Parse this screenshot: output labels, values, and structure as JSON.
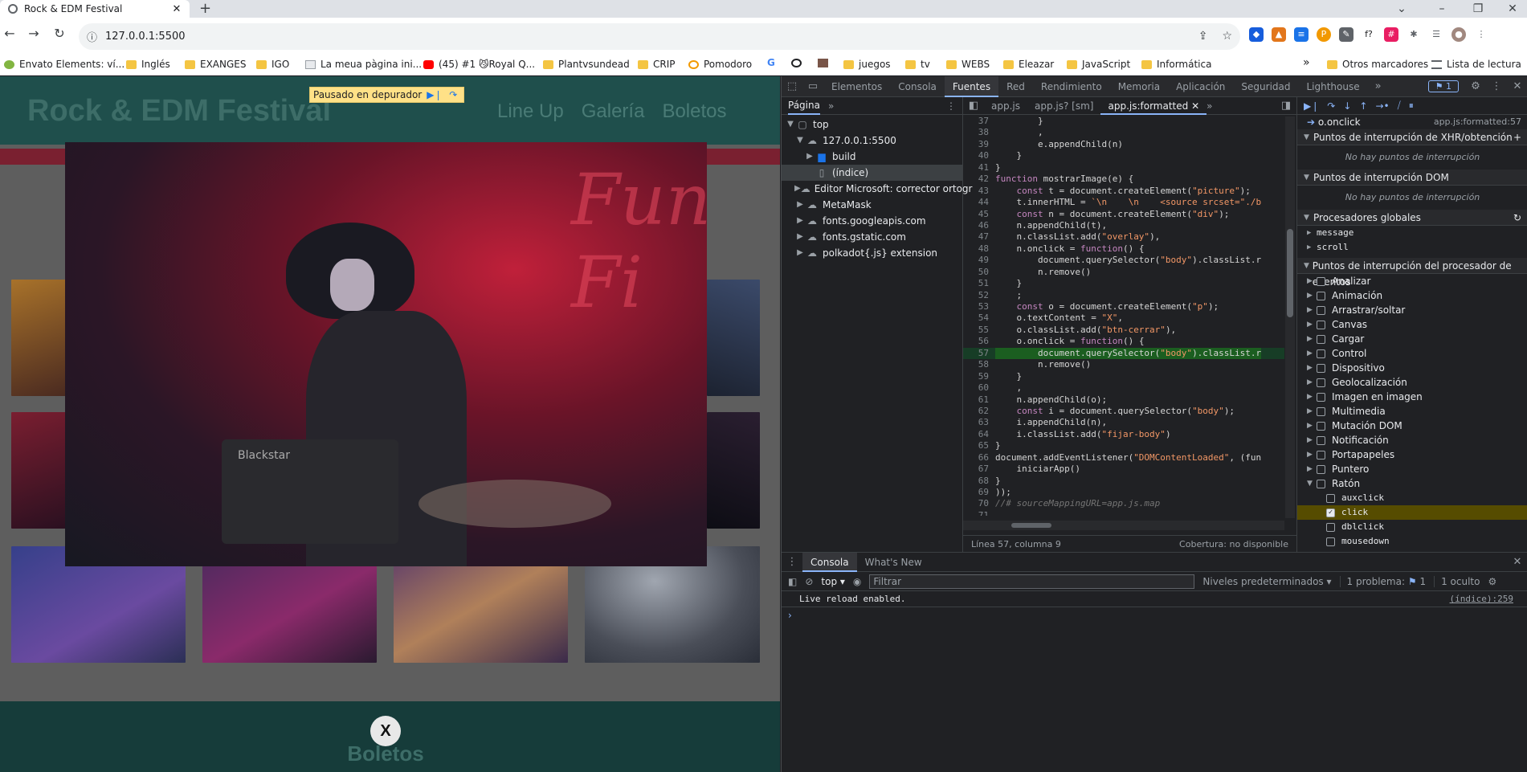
{
  "browser": {
    "tab_title": "Rock & EDM Festival",
    "url": "127.0.0.1:5500",
    "bookmarks": [
      "Envato Elements: ví...",
      "Inglés",
      "EXANGES",
      "IGO",
      "La meua pàgina ini...",
      "(45) #1 😼Royal Q...",
      "Plantvsundead",
      "CRIP",
      "Pomodoro",
      "",
      "",
      "",
      "juegos",
      "tv",
      "WEBS",
      "Eleazar",
      "JavaScript",
      "Informática"
    ],
    "other_bookmarks": "Otros marcadores",
    "reading_list": "Lista de lectura",
    "overflow": "»"
  },
  "site": {
    "title": "Rock & EDM Festival",
    "nav": [
      "Line Up",
      "Galería",
      "Boletos"
    ],
    "paused_text": "Pausado en depurador",
    "photo_sign": "Fun Fi",
    "amp_label": "Blackstar",
    "close_label": "X",
    "footer_title": "Boletos"
  },
  "devtools": {
    "tabs": [
      "Elementos",
      "Consola",
      "Fuentes",
      "Red",
      "Rendimiento",
      "Memoria",
      "Aplicación",
      "Seguridad",
      "Lighthouse"
    ],
    "active_tab": "Fuentes",
    "issue_count": "1",
    "navigator_tab": "Página",
    "tree": [
      {
        "label": "top",
        "level": 0,
        "icon": "frame",
        "open": true
      },
      {
        "label": "127.0.0.1:5500",
        "level": 1,
        "icon": "cloud",
        "open": true
      },
      {
        "label": "build",
        "level": 2,
        "icon": "folder",
        "open": false
      },
      {
        "label": "(índice)",
        "level": 2,
        "icon": "file",
        "selected": true
      },
      {
        "label": "Editor Microsoft: corrector ortogr",
        "level": 1,
        "icon": "cloud",
        "open": false
      },
      {
        "label": "MetaMask",
        "level": 1,
        "icon": "cloud",
        "open": false
      },
      {
        "label": "fonts.googleapis.com",
        "level": 1,
        "icon": "cloud",
        "open": false
      },
      {
        "label": "fonts.gstatic.com",
        "level": 1,
        "icon": "cloud",
        "open": false
      },
      {
        "label": "polkadot{.js} extension",
        "level": 1,
        "icon": "cloud",
        "open": false
      }
    ],
    "editor_tabs": [
      "app.js",
      "app.js? [sm]",
      "app.js:formatted"
    ],
    "code": [
      {
        "n": "37",
        "t": "        }"
      },
      {
        "n": "38",
        "t": "        ,"
      },
      {
        "n": "39",
        "t": "        e.appendChild(n)"
      },
      {
        "n": "40",
        "t": "    }"
      },
      {
        "n": "41",
        "t": "}"
      },
      {
        "n": "42",
        "t": "function mostrarImage(e) {"
      },
      {
        "n": "43",
        "t": "    const t = document.createElement(\"picture\");"
      },
      {
        "n": "44",
        "t": "    t.innerHTML = `\\n    \\n    <source srcset=\"./b"
      },
      {
        "n": "45",
        "t": "    const n = document.createElement(\"div\");"
      },
      {
        "n": "46",
        "t": "    n.appendChild(t),"
      },
      {
        "n": "47",
        "t": "    n.classList.add(\"overlay\"),"
      },
      {
        "n": "48",
        "t": "    n.onclick = function() {"
      },
      {
        "n": "49",
        "t": "        document.querySelector(\"body\").classList.r"
      },
      {
        "n": "50",
        "t": "        n.remove()"
      },
      {
        "n": "51",
        "t": "    }"
      },
      {
        "n": "52",
        "t": "    ;"
      },
      {
        "n": "53",
        "t": "    const o = document.createElement(\"p\");"
      },
      {
        "n": "54",
        "t": "    o.textContent = \"X\","
      },
      {
        "n": "55",
        "t": "    o.classList.add(\"btn-cerrar\"),"
      },
      {
        "n": "56",
        "t": "    o.onclick = function() {"
      },
      {
        "n": "57",
        "t": "        document.querySelector(\"body\").classList.r",
        "hl": true
      },
      {
        "n": "58",
        "t": "        n.remove()"
      },
      {
        "n": "59",
        "t": "    }"
      },
      {
        "n": "60",
        "t": "    ,"
      },
      {
        "n": "61",
        "t": "    n.appendChild(o);"
      },
      {
        "n": "62",
        "t": "    const i = document.querySelector(\"body\");"
      },
      {
        "n": "63",
        "t": "    i.appendChild(n),"
      },
      {
        "n": "64",
        "t": "    i.classList.add(\"fijar-body\")"
      },
      {
        "n": "65",
        "t": "}"
      },
      {
        "n": "66",
        "t": "document.addEventListener(\"DOMContentLoaded\", (fun"
      },
      {
        "n": "67",
        "t": "    iniciarApp()"
      },
      {
        "n": "68",
        "t": "}"
      },
      {
        "n": "69",
        "t": "));"
      },
      {
        "n": "70",
        "t": "//# sourceMappingURL=app.js.map"
      },
      {
        "n": "71",
        "t": ""
      }
    ],
    "status_position": "Línea 57, columna 9",
    "status_coverage": "Cobertura: no disponible",
    "callstack_fn": "o.onclick",
    "callstack_loc": "app.js:formatted:57",
    "sections": {
      "xhr": "Puntos de interrupción de XHR/obtención",
      "no_xhr": "No hay puntos de interrupción",
      "dom": "Puntos de interrupción DOM",
      "no_dom": "No hay puntos de interrupción",
      "global": "Procesadores globales",
      "global_items": [
        "message",
        "scroll"
      ],
      "events": "Puntos de interrupción del procesador de eventos"
    },
    "event_categories": [
      "Analizar",
      "Animación",
      "Arrastrar/soltar",
      "Canvas",
      "Cargar",
      "Control",
      "Dispositivo",
      "Geolocalización",
      "Imagen en imagen",
      "Multimedia",
      "Mutación DOM",
      "Notificación",
      "Portapapeles",
      "Puntero",
      "Ratón"
    ],
    "mouse_events": [
      {
        "name": "auxclick",
        "checked": false
      },
      {
        "name": "click",
        "checked": true
      },
      {
        "name": "dblclick",
        "checked": false
      },
      {
        "name": "mousedown",
        "checked": false
      }
    ],
    "drawer_tabs": [
      "Consola",
      "What's New"
    ],
    "console_context": "top",
    "filter_placeholder": "Filtrar",
    "levels": "Niveles predeterminados",
    "problems": "1 problema:",
    "problems_count": "1",
    "hidden": "1 oculto",
    "console_message": "Live reload enabled.",
    "console_source": "(índice):259",
    "prompt_symbol": "›"
  }
}
